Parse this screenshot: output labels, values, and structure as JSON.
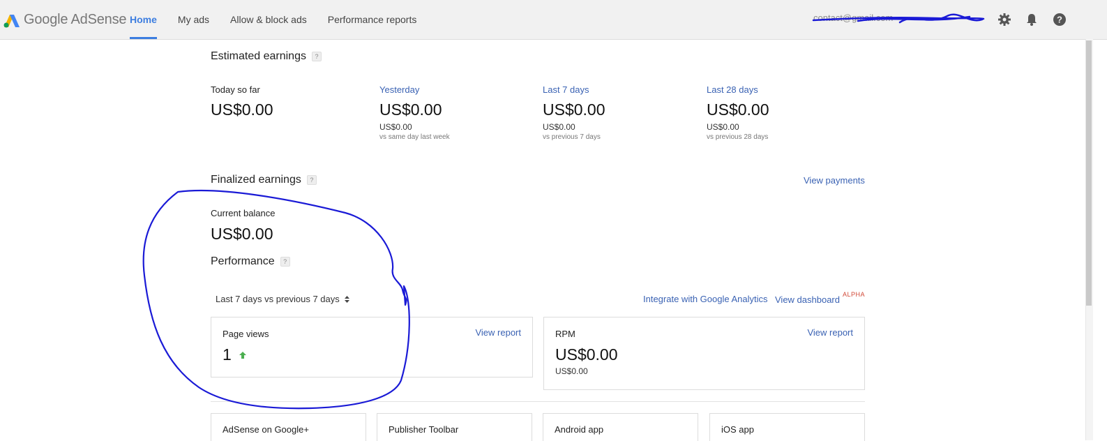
{
  "brand": {
    "name": "Google AdSense"
  },
  "nav": {
    "items": [
      {
        "label": "Home",
        "active": true
      },
      {
        "label": "My ads",
        "active": false
      },
      {
        "label": "Allow & block ads",
        "active": false
      },
      {
        "label": "Performance reports",
        "active": false
      }
    ]
  },
  "account": {
    "email": "contact@gmail.com",
    "redacted": true
  },
  "icons": {
    "settings": "gear-icon",
    "notifications": "bell-icon",
    "help": "help-icon"
  },
  "estimated": {
    "title": "Estimated earnings",
    "help": "?",
    "columns": [
      {
        "label": "Today so far",
        "value": "US$0.00",
        "sub": "",
        "note": ""
      },
      {
        "label": "Yesterday",
        "value": "US$0.00",
        "sub": "US$0.00",
        "note": "vs same day last week"
      },
      {
        "label": "Last 7 days",
        "value": "US$0.00",
        "sub": "US$0.00",
        "note": "vs previous 7 days"
      },
      {
        "label": "Last 28 days",
        "value": "US$0.00",
        "sub": "US$0.00",
        "note": "vs previous 28 days"
      }
    ]
  },
  "finalized": {
    "title": "Finalized earnings",
    "help": "?",
    "view_payments": "View payments",
    "balance_label": "Current balance",
    "balance_value": "US$0.00"
  },
  "performance": {
    "title": "Performance",
    "help": "?",
    "range": "Last 7 days vs previous 7 days",
    "integrate_link": "Integrate with Google Analytics",
    "dashboard_link": "View dashboard",
    "dashboard_badge": "ALPHA",
    "cards": [
      {
        "title": "Page views",
        "value": "1",
        "trend": "up",
        "sub": "",
        "link": "View report"
      },
      {
        "title": "RPM",
        "value": "US$0.00",
        "trend": "",
        "sub": "US$0.00",
        "link": "View report"
      }
    ]
  },
  "apps": [
    {
      "label": "AdSense on Google+"
    },
    {
      "label": "Publisher Toolbar"
    },
    {
      "label": "Android app"
    },
    {
      "label": "iOS app"
    }
  ],
  "colors": {
    "accent": "#3d7ee0",
    "link": "#3a62b3",
    "annotation": "#1a1ad6",
    "trend_up": "#4caf50",
    "alpha": "#d14836"
  }
}
